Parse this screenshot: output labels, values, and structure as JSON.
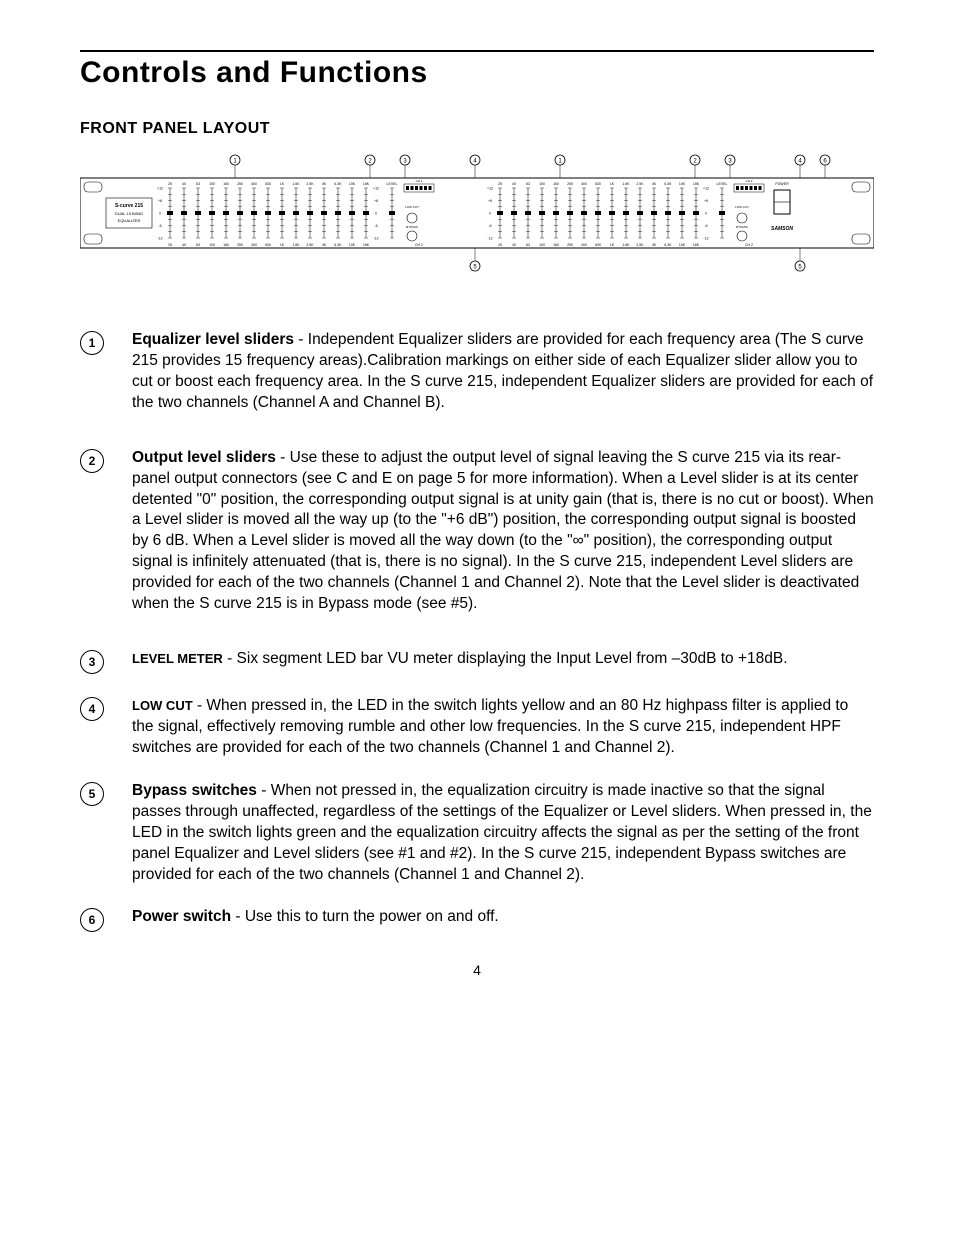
{
  "heading": "Controls and Functions",
  "subheading": "FRONT PANEL LAYOUT",
  "page_number": "4",
  "diagram": {
    "device_label_line1": "S-curve 215",
    "device_label_line2": "DUAL 15 BAND",
    "device_label_line3": "EQUALIZER",
    "brand": "SAMSON",
    "ch1_label": "CH 1",
    "ch2_label": "CH 2",
    "power_label": "POWER",
    "low_cut_label": "LOW CUT",
    "bypass_label": "BYPASS",
    "level_label": "LEVEL",
    "frequencies": [
      "25",
      "40",
      "63",
      "100",
      "160",
      "250",
      "400",
      "630",
      "1K",
      "1.6K",
      "2.5K",
      "4K",
      "6.3K",
      "10K",
      "16K"
    ],
    "slider_marks": [
      "+12",
      "+6",
      "0",
      "-6",
      "-12"
    ],
    "callouts": [
      "1",
      "2",
      "3",
      "4",
      "5",
      "6"
    ]
  },
  "items": [
    {
      "num": "1",
      "lead": "Equalizer level sliders",
      "lead_style": "normal",
      "text": " -  Independent Equalizer sliders are provided for each frequency area (The S curve 215  provides 15 frequency areas).Calibration markings on either side of each Equalizer slider allow you to cut or boost each  frequency area.  In the S curve 215, independent Equalizer sliders are provided for each of the two channels (Channel A and Channel B)."
    },
    {
      "num": "2",
      "lead": "Output level sliders",
      "lead_style": "normal",
      "text": " - Use these to adjust the output level of signal leaving the S curve 215 via its rear-panel output connectors (see C and E on page 5 for more information).  When a Level slider is at its center detented \"0\" position, the corresponding output signal is at unity gain (that is, there is no cut or boost). When a Level slider is moved all the way up (to the \"+6 dB\") position, the corresponding output signal is boosted by 6 dB. When a Level slider is moved all the way down (to the \"∞\" position), the corresponding output signal is infinitely attenuated (that is, there is no signal).  In the S curve 215, independent Level sliders are provided for each of the two channels (Channel 1 and Channel 2).  Note that the Level slider is deactivated when the S curve 215 is in Bypass mode (see #5)."
    },
    {
      "num": "3",
      "lead": "LEVEL METER",
      "lead_style": "small",
      "text": " - Six segment LED bar VU meter displaying the Input Level from –30dB to +18dB."
    },
    {
      "num": "4",
      "lead": "LOW CUT",
      "lead_style": "small",
      "text": " -  When pressed in, the LED in the switch lights yellow and an 80 Hz highpass filter is applied to the signal, effectively removing rumble and other low frequencies.  In the  S curve 215, independent HPF switches are provided for each of the two channels (Channel 1 and Channel 2)."
    },
    {
      "num": "5",
      "lead": "Bypass switches",
      "lead_style": "normal",
      "text": " -  When not pressed in, the equalization circuitry is made inactive so that the signal passes through unaffected, regardless of the settings of the Equalizer or Level sliders. When pressed in, the LED in the switch lights green and the equalization circuitry affects the signal as per the setting of the front panel Equalizer and Level sliders (see #1 and #2).  In the S curve 215, independent Bypass switches are provided for each of the two channels (Channel 1 and Channel 2)."
    },
    {
      "num": "6",
      "lead": "Power switch",
      "lead_style": "normal",
      "text": " -  Use this to turn the power on and off."
    }
  ]
}
